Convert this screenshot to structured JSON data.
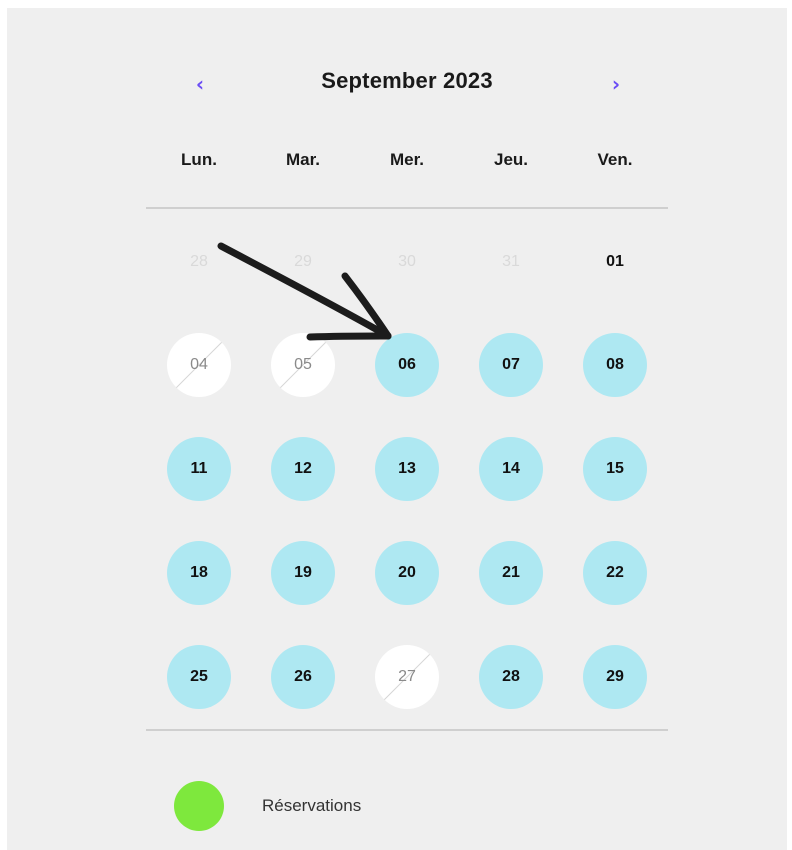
{
  "calendar": {
    "month_title": "September 2023",
    "prev_label": "‹",
    "next_label": "›",
    "accent_color": "#6a4cf5",
    "weekdays": [
      "Lun.",
      "Mar.",
      "Mer.",
      "Jeu.",
      "Ven."
    ],
    "weeks": [
      [
        {
          "label": "28",
          "state": "outside"
        },
        {
          "label": "29",
          "state": "outside"
        },
        {
          "label": "30",
          "state": "outside"
        },
        {
          "label": "31",
          "state": "outside"
        },
        {
          "label": "01",
          "state": "plain"
        }
      ],
      [
        {
          "label": "04",
          "state": "unavailable"
        },
        {
          "label": "05",
          "state": "unavailable"
        },
        {
          "label": "06",
          "state": "available"
        },
        {
          "label": "07",
          "state": "available"
        },
        {
          "label": "08",
          "state": "available"
        }
      ],
      [
        {
          "label": "11",
          "state": "available"
        },
        {
          "label": "12",
          "state": "available"
        },
        {
          "label": "13",
          "state": "available"
        },
        {
          "label": "14",
          "state": "available"
        },
        {
          "label": "15",
          "state": "available"
        }
      ],
      [
        {
          "label": "18",
          "state": "available"
        },
        {
          "label": "19",
          "state": "available"
        },
        {
          "label": "20",
          "state": "available"
        },
        {
          "label": "21",
          "state": "available"
        },
        {
          "label": "22",
          "state": "available"
        }
      ],
      [
        {
          "label": "25",
          "state": "available"
        },
        {
          "label": "26",
          "state": "available"
        },
        {
          "label": "27",
          "state": "unavailable"
        },
        {
          "label": "28",
          "state": "available"
        },
        {
          "label": "29",
          "state": "available"
        }
      ]
    ],
    "available_color": "#aee8f2",
    "unavailable_color": "#ffffff"
  },
  "legend": {
    "items": [
      {
        "label": "Réservations",
        "color": "#7ee83d"
      }
    ]
  },
  "annotation": {
    "icon": "arrow-icon",
    "points_to": "06"
  }
}
